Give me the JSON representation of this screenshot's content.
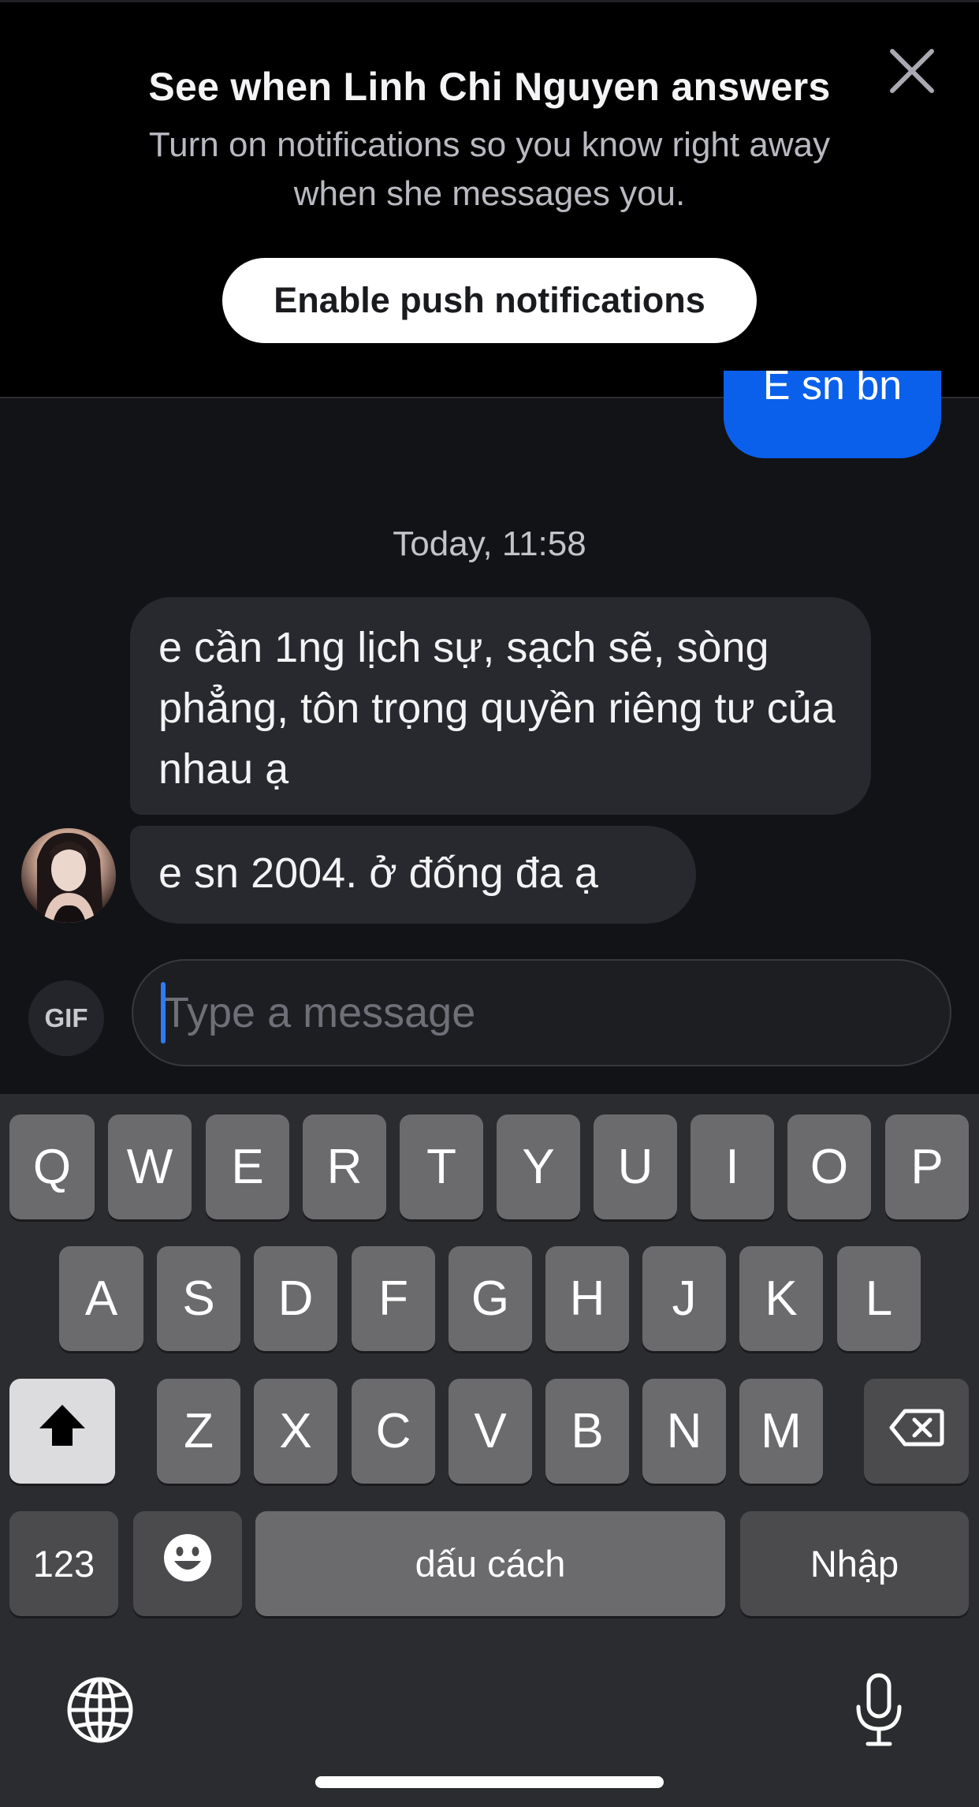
{
  "banner": {
    "title": "See when Linh Chi Nguyen answers",
    "body": "Turn on notifications so you know right away when she messages you.",
    "enable_button": "Enable push notifications",
    "close_icon": "close-icon"
  },
  "chat": {
    "sent_message": "E sn bn",
    "timestamp": "Today, 11:58",
    "received_messages": [
      "e cần 1ng lịch sự, sạch sẽ, sòng phẳng, tôn trọng quyền riêng tư của nhau ạ",
      "e sn 2004. ở đống đa ạ"
    ],
    "colors": {
      "sent_bubble": "#0a60ea",
      "received_bubble": "#28292e",
      "background": "#121316"
    }
  },
  "composer": {
    "gif_label": "GIF",
    "placeholder": "Type a message",
    "value": ""
  },
  "keyboard": {
    "row1": [
      "Q",
      "W",
      "E",
      "R",
      "T",
      "Y",
      "U",
      "I",
      "O",
      "P"
    ],
    "row2": [
      "A",
      "S",
      "D",
      "F",
      "G",
      "H",
      "J",
      "K",
      "L"
    ],
    "row3": [
      "Z",
      "X",
      "C",
      "V",
      "B",
      "N",
      "M"
    ],
    "numbers_key": "123",
    "space_key": "dấu cách",
    "return_key": "Nhập",
    "shift_icon": "shift-icon",
    "backspace_icon": "backspace-icon",
    "emoji_icon": "emoji-icon",
    "globe_icon": "globe-icon",
    "mic_icon": "microphone-icon"
  }
}
